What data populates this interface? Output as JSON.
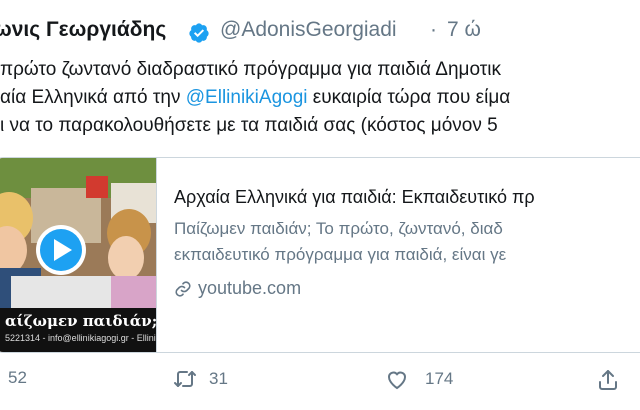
{
  "tweet": {
    "author_name": "ωνις Γεωργιάδης",
    "handle": "@AdonisGeorgiadi",
    "separator": "·",
    "time": "7 ώ",
    "lines": [
      {
        "before": "πρώτο ζωντανό διαδραστικό πρόγραμμα για παιδιά Δημοτικ",
        "mention": "",
        "after": ""
      },
      {
        "before": "αία Ελληνικά από την ",
        "mention": "@EllinikiAgogi",
        "after": " ευκαιρία τώρα που είμα"
      },
      {
        "before": "ι να το παρακολουθήσετε με τα παιδιά σας (κόστος μόνον 5",
        "mention": "",
        "after": ""
      }
    ]
  },
  "card": {
    "thumb_caption": "αίζωμεν παιδιάν;",
    "thumb_contact": "5221314 - info@ellinikiagogi.gr - Ellini",
    "title": "Αρχαία Ελληνικά για παιδιά: Εκπαιδευτικό πρ",
    "desc_line1": "Παίζωμεν παιδιάν; Το πρώτο, ζωντανό, διαδ",
    "desc_line2": "εκπαιδευτικό πρόγραμμα για παιδιά, είναι γε",
    "link": "youtube.com"
  },
  "actions": {
    "replies": "52",
    "retweets": "31",
    "likes": "174"
  },
  "colors": {
    "accent": "#1da1f2",
    "mention": "#1b95e0",
    "muted": "#657786",
    "border": "#ccd6dd"
  }
}
